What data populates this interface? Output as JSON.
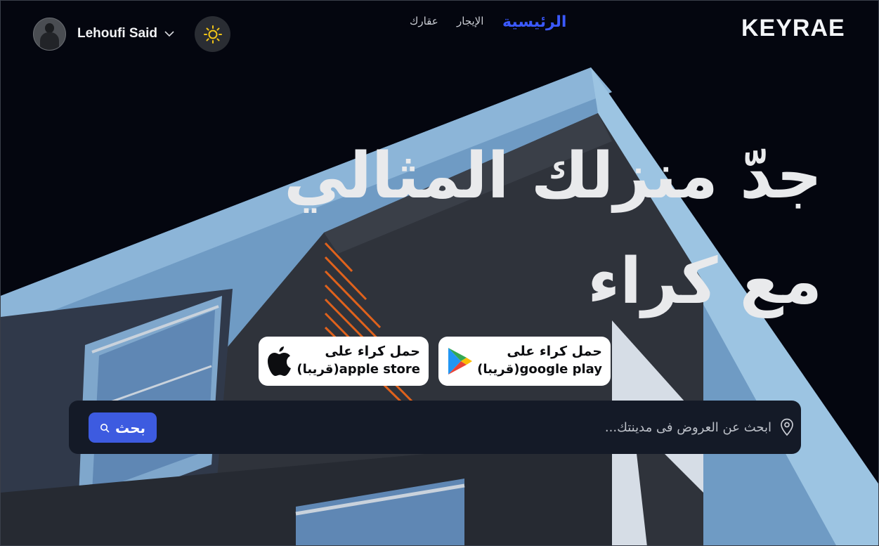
{
  "header": {
    "brand": "KEYRAE",
    "nav": [
      {
        "label": "الرئيسية",
        "active": true
      },
      {
        "label": "الإيجار",
        "active": false
      },
      {
        "label": "عقارك",
        "active": false
      }
    ],
    "user": {
      "name": "Lehoufi Said"
    },
    "theme_icon": "sun-icon"
  },
  "hero": {
    "title_line1": "جدّ منزلك المثالي",
    "title_line2": "مع كراء"
  },
  "stores": {
    "google": {
      "line1": "حمل كراء على",
      "line2": "(قريبا)google play",
      "icon": "google-play-icon"
    },
    "apple": {
      "line1": "حمل كراء على",
      "line2": "(قريبا)apple store",
      "icon": "apple-icon"
    }
  },
  "search": {
    "placeholder": "ابحث عن العروض فى مدينتك...",
    "button_label": "بحث",
    "icon": "location-pin-icon"
  },
  "colors": {
    "accent": "#3b59ff",
    "button": "#3d5be0",
    "background": "#04060f",
    "search_bg": "#141a27"
  }
}
